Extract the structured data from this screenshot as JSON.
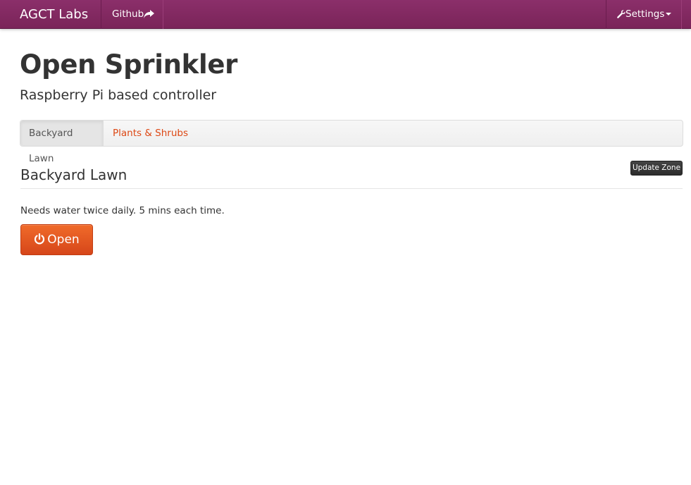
{
  "navbar": {
    "brand": "AGCT Labs",
    "github_label": "Github",
    "settings_label": "Settings",
    "accent_color": "#7f2760"
  },
  "header": {
    "title": "Open Sprinkler",
    "subtitle": "Raspberry Pi based controller"
  },
  "tabs": [
    {
      "label": "Backyard Lawn",
      "active": true
    },
    {
      "label": "Plants & Shrubs",
      "active": false
    }
  ],
  "zone": {
    "title": "Backyard Lawn",
    "update_label": "Update Zone",
    "description": "Needs water twice daily. 5 mins each time.",
    "open_label": "Open",
    "open_icon": "power-icon",
    "open_color": "#e2541f"
  }
}
